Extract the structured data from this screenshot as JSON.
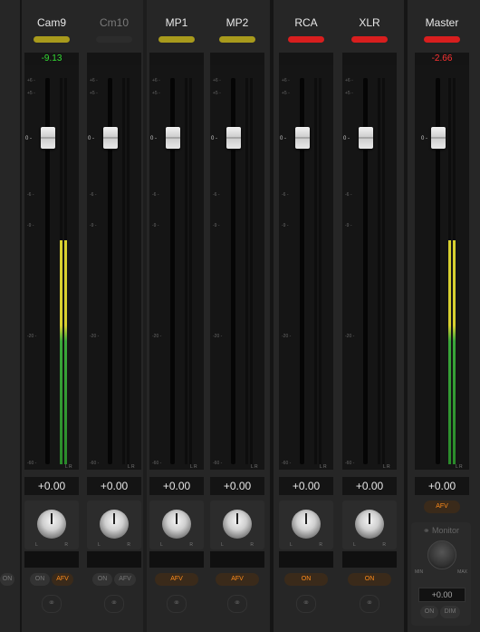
{
  "scale_labels": [
    "+6 -",
    "+5 -",
    "0 -",
    "-6 -",
    "-9 -",
    "-20 -",
    "-60 -"
  ],
  "meter_lr": "L R",
  "pan_left": "L",
  "pan_right": "R",
  "colors": {
    "tally_yellow": "#a89a1c",
    "tally_red": "#d81e1e",
    "tally_none": "#2c2c2c",
    "peak_green": "#33dd33",
    "peak_red": "#ff3333",
    "afv_orange": "#ff8c1a"
  },
  "channels": [
    {
      "name": "Cam9",
      "tally": "yellow",
      "peak": "-9.13",
      "peak_color": "green",
      "gain": "+0.00",
      "meter_level_left": 0.58,
      "meter_level_right": 0.58,
      "btn_on": "ON",
      "btn_afv": "AFV",
      "on_active": false,
      "afv_active": true,
      "dim": false
    },
    {
      "name": "Cm10",
      "tally": "none",
      "peak": "",
      "gain": "+0.00",
      "meter_level_left": 0,
      "meter_level_right": 0,
      "btn_on": "ON",
      "btn_afv": "AFV",
      "on_active": false,
      "afv_active": false,
      "dim": true
    },
    {
      "name": "MP1",
      "tally": "yellow",
      "peak": "",
      "gain": "+0.00",
      "meter_level_left": 0,
      "meter_level_right": 0,
      "btn_afv": "AFV",
      "afv_active": true,
      "dim": false
    },
    {
      "name": "MP2",
      "tally": "yellow",
      "peak": "",
      "gain": "+0.00",
      "meter_level_left": 0,
      "meter_level_right": 0,
      "btn_afv": "AFV",
      "afv_active": true,
      "dim": false
    },
    {
      "name": "RCA",
      "tally": "red",
      "peak": "",
      "gain": "+0.00",
      "meter_level_left": 0,
      "meter_level_right": 0,
      "btn_on": "ON",
      "on_active": true,
      "dim": false
    },
    {
      "name": "XLR",
      "tally": "red",
      "peak": "",
      "gain": "+0.00",
      "meter_level_left": 0,
      "meter_level_right": 0,
      "btn_on": "ON",
      "on_active": true,
      "dim": false
    }
  ],
  "master": {
    "name": "Master",
    "tally": "red",
    "peak": "-2.66",
    "gain": "+0.00",
    "meter_level_left": 0.58,
    "meter_level_right": 0.58,
    "afv_label": "AFV"
  },
  "monitor": {
    "title": "Monitor",
    "min_label": "MIN",
    "max_label": "MAX",
    "level": "+0.00",
    "btn_on": "ON",
    "btn_dim": "DIM"
  },
  "left_edge_btn": "ON"
}
